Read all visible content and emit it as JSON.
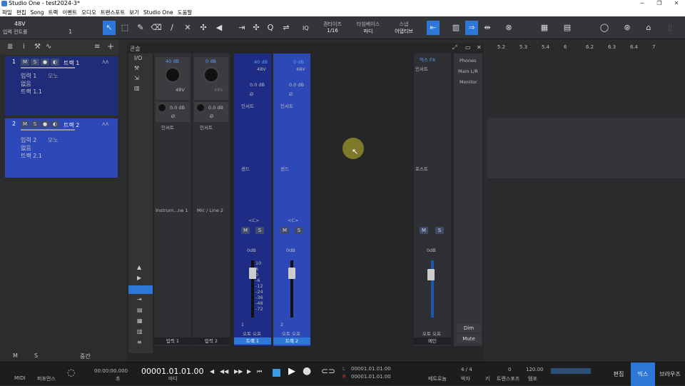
{
  "window": {
    "title": "Studio One - test2024-3*",
    "min": "─",
    "max": "❐",
    "close": "✕"
  },
  "menu": [
    "파일",
    "편집",
    "Song",
    "트랙",
    "이벤트",
    "오디오",
    "트랜스포트",
    "보기",
    "Studio One",
    "도움말"
  ],
  "toolbar": {
    "input_label": "48V",
    "input_sub": "입력 컨트롤",
    "input_num": "1",
    "iq": "IQ",
    "quantize_label": "퀀타이즈",
    "quantize_value": "1/16",
    "timebase_label": "타임베이스",
    "timebase_value": "마디",
    "snap_label": "스냅",
    "snap_value": "어댑티브"
  },
  "tracks": [
    {
      "num": "1",
      "name": "트랙 1",
      "m": "M",
      "s": "S",
      "input": "입력 1",
      "mono": "모노",
      "fx": "없음",
      "send": "트랙 1.1"
    },
    {
      "num": "2",
      "name": "트랙 2",
      "m": "M",
      "s": "S",
      "input": "입력 2",
      "mono": "모노",
      "fx": "없음",
      "send": "트랙 2.1"
    }
  ],
  "left_footer": {
    "m": "M",
    "s": "S",
    "mode": "중간"
  },
  "mixer": {
    "header": "콘솔",
    "io": "I/O",
    "inputs": [
      {
        "gain": "40 dB",
        "phantom": "48V",
        "trim": "0.0 dB",
        "phase": "Ø",
        "insert": "인서트",
        "name": "Instrum...ne 1",
        "bottom": "입력 1"
      },
      {
        "gain": "0 dB",
        "phantom": "48V",
        "trim": "0.0 dB",
        "phase": "Ø",
        "insert": "인서트",
        "name": "Mic / Line 2",
        "bottom": "입력 2"
      }
    ],
    "channels": [
      {
        "gain": "40 dB",
        "phantom": "48V",
        "trim": "0.0 dB",
        "phase": "Ø",
        "insert": "인서트",
        "send": "센드",
        "pan": "<C>",
        "m": "M",
        "s": "S",
        "vol": "0dB",
        "num": "1",
        "automation": "오토 오프",
        "bottom": "트랙 1"
      },
      {
        "gain": "0 dB",
        "phantom": "48V",
        "trim": "0.0 dB",
        "phase": "Ø",
        "insert": "인서트",
        "send": "센드",
        "pan": "<C>",
        "m": "M",
        "s": "S",
        "vol": "0dB",
        "num": "2",
        "automation": "오토 오프",
        "bottom": "트랙 2"
      }
    ],
    "main": {
      "fx": "믹스 FX",
      "insert": "인서트",
      "post": "포스트",
      "m": "M",
      "s": "S",
      "vol": "0dB",
      "automation": "오토 오프",
      "bottom": "메인"
    },
    "monitor": {
      "phones": "Phones",
      "main": "Main L/R",
      "monitor": "Monitor",
      "dim": "Dim",
      "mute": "Mute"
    },
    "scale": [
      "10",
      "6",
      "0",
      "-6",
      "-12",
      "-24",
      "-36",
      "-48",
      "-72"
    ]
  },
  "ruler": [
    "5.2",
    "5.3",
    "5.4",
    "6",
    "6.2",
    "6.3",
    "6.4",
    "7"
  ],
  "transport": {
    "midi": "MIDI",
    "perf": "퍼포먼스",
    "time": "00:00:00.000",
    "time_unit": "초",
    "pos": "00001.01.01.00",
    "pos_unit": "마디",
    "l": "L",
    "r": "R",
    "l_val": "00001.01.01.00",
    "r_val": "00001.01.01.00",
    "metronome": "메트로놈",
    "sig": "4 / 4",
    "sig_label": "박자",
    "key_label": "키",
    "tempo": "120.00",
    "tempo_label": "템포",
    "transpose": "0",
    "transpose_label": "트랜스포즈"
  },
  "bottom_tabs": [
    {
      "label": "편집"
    },
    {
      "label": "믹스"
    },
    {
      "label": "브라우즈"
    }
  ]
}
